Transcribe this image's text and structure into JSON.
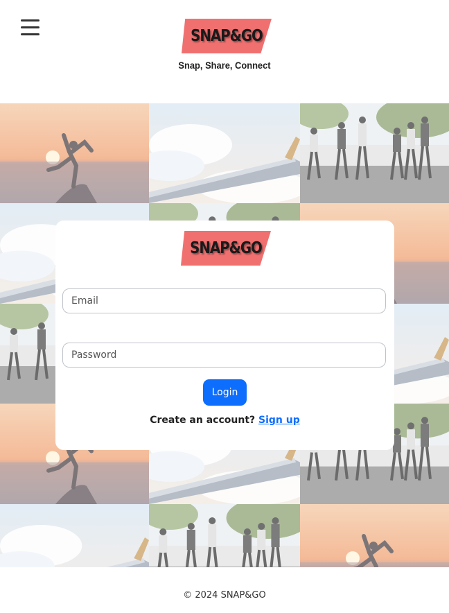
{
  "header": {
    "menu_icon": "hamburger-menu-icon",
    "logo_text": "SNAP&GO",
    "tagline": "Snap, Share, Connect"
  },
  "colors": {
    "logo_plate": "#f07070",
    "primary": "#0d6efd"
  },
  "gallery": {
    "images": [
      "sunset-jump-photo",
      "airplane-wing-photo",
      "running-group-photo"
    ]
  },
  "login_card": {
    "logo_text": "SNAP&GO",
    "email_placeholder": "Email",
    "email_value": "",
    "password_placeholder": "Password",
    "password_value": "",
    "login_label": "Login",
    "signup_prompt": "Create an account?",
    "signup_link": "Sign up"
  },
  "footer": {
    "copyright": "© 2024 SNAP&GO"
  }
}
